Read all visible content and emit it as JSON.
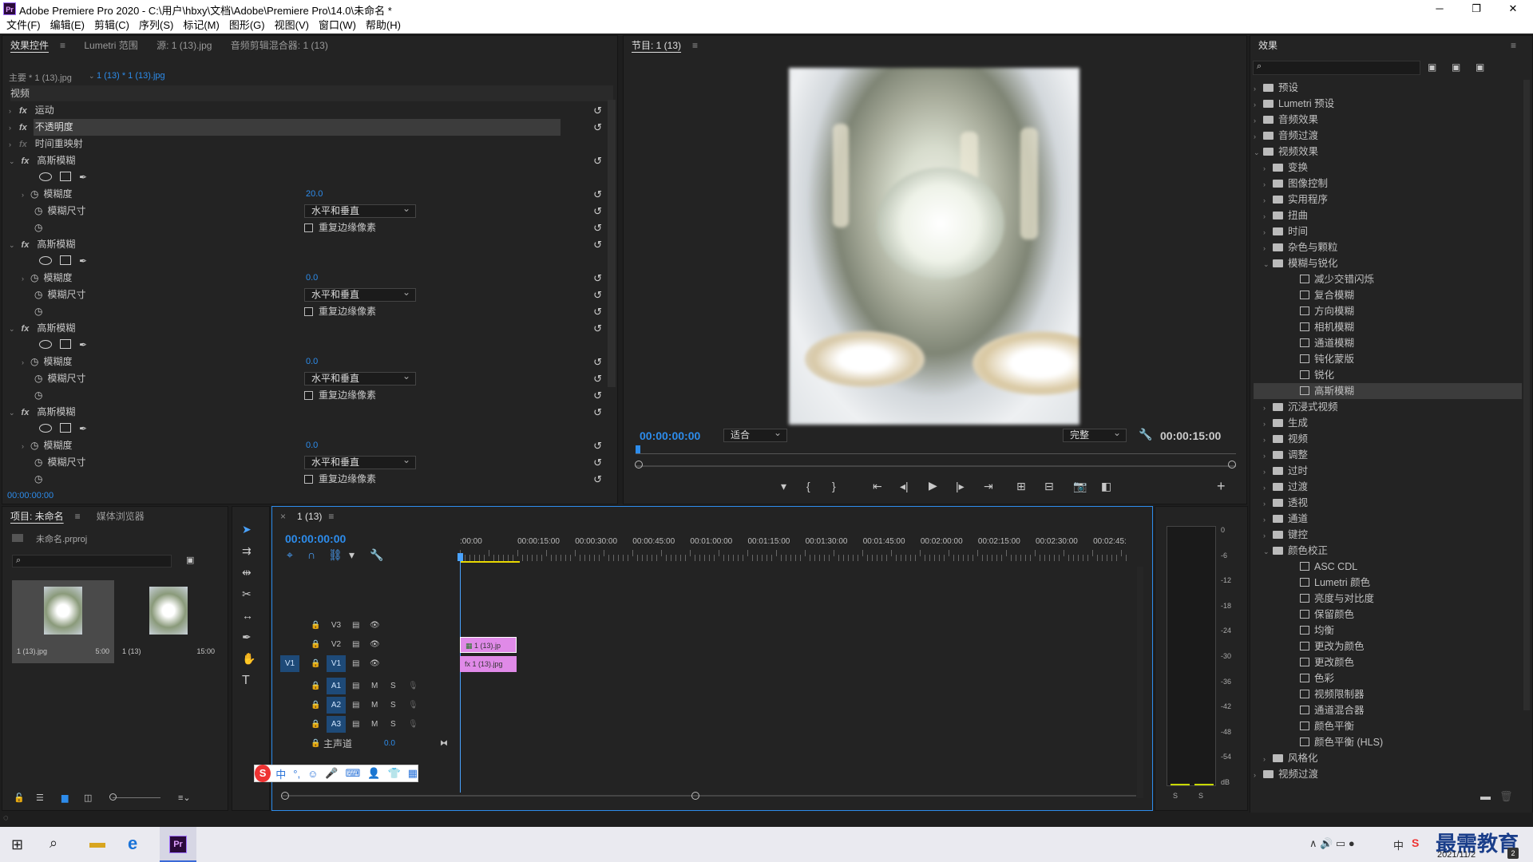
{
  "window": {
    "title": "Adobe Premiere Pro 2020 - C:\\用户\\hbxy\\文档\\Adobe\\Premiere Pro\\14.0\\未命名 *",
    "app_icon": "Pr",
    "minimize": "─",
    "restore": "❐",
    "close": "✕"
  },
  "menu": [
    "文件(F)",
    "编辑(E)",
    "剪辑(C)",
    "序列(S)",
    "标记(M)",
    "图形(G)",
    "视图(V)",
    "窗口(W)",
    "帮助(H)"
  ],
  "effect_controls": {
    "tabs": [
      "效果控件",
      "Lumetri 范围",
      "源: 1 (13).jpg",
      "音频剪辑混合器: 1 (13)"
    ],
    "master": "主要 * 1 (13).jpg",
    "clip": "1 (13) * 1 (13).jpg",
    "section": "视频",
    "fixed": [
      "运动",
      "不透明度",
      "时间重映射"
    ],
    "blur_name": "高斯模糊",
    "blurriness_label": "模糊度",
    "dims_label": "模糊尺寸",
    "repeat_label": "重复边缘像素",
    "dims_value": "水平和垂直",
    "blur_values": [
      "20.0",
      "0.0",
      "0.0",
      "0.0"
    ],
    "timecode": "00:00:00:00"
  },
  "program": {
    "title": "节目: 1 (13)",
    "timecode": "00:00:00:00",
    "fit": "适合",
    "quality": "完整",
    "duration": "00:00:15:00"
  },
  "project": {
    "tabs": [
      "项目: 未命名",
      "媒体浏览器"
    ],
    "file": "未命名.prproj",
    "items": [
      {
        "name": "1 (13).jpg",
        "dur": "5:00"
      },
      {
        "name": "1 (13)",
        "dur": "15:00"
      }
    ]
  },
  "timeline": {
    "tab": "1 (13)",
    "timecode": "00:00:00:00",
    "ruler": [
      ":00:00",
      "00:00:15:00",
      "00:00:30:00",
      "00:00:45:00",
      "00:01:00:00",
      "00:01:15:00",
      "00:01:30:00",
      "00:01:45:00",
      "00:02:00:00",
      "00:02:15:00",
      "00:02:30:00",
      "00:02:45:"
    ],
    "video_tracks": [
      "V3",
      "V2",
      "V1"
    ],
    "audio_tracks": [
      "A1",
      "A2",
      "A3"
    ],
    "src_v": "V1",
    "m": "M",
    "s": "S",
    "master": "主声道",
    "master_val": "0.0",
    "clips": [
      {
        "label": "1 (13).jp"
      },
      {
        "label": "1 (13).jpg"
      }
    ]
  },
  "meter": {
    "ticks": [
      "0",
      "-6",
      "-12",
      "-18",
      "-24",
      "-30",
      "-36",
      "-42",
      "-48",
      "-54",
      "dB"
    ],
    "solo": "S"
  },
  "effects": {
    "title": "效果",
    "tree": [
      {
        "t": "f",
        "l": 0,
        "n": "预设"
      },
      {
        "t": "f",
        "l": 0,
        "n": "Lumetri 预设"
      },
      {
        "t": "f",
        "l": 0,
        "n": "音频效果"
      },
      {
        "t": "f",
        "l": 0,
        "n": "音频过渡"
      },
      {
        "t": "f",
        "l": 0,
        "n": "视频效果",
        "open": true
      },
      {
        "t": "f",
        "l": 1,
        "n": "变换"
      },
      {
        "t": "f",
        "l": 1,
        "n": "图像控制"
      },
      {
        "t": "f",
        "l": 1,
        "n": "实用程序"
      },
      {
        "t": "f",
        "l": 1,
        "n": "扭曲"
      },
      {
        "t": "f",
        "l": 1,
        "n": "时间"
      },
      {
        "t": "f",
        "l": 1,
        "n": "杂色与颗粒"
      },
      {
        "t": "f",
        "l": 1,
        "n": "模糊与锐化",
        "open": true
      },
      {
        "t": "e",
        "l": 2,
        "n": "减少交错闪烁"
      },
      {
        "t": "e",
        "l": 2,
        "n": "复合模糊"
      },
      {
        "t": "e",
        "l": 2,
        "n": "方向模糊"
      },
      {
        "t": "e",
        "l": 2,
        "n": "相机模糊"
      },
      {
        "t": "e",
        "l": 2,
        "n": "通道模糊"
      },
      {
        "t": "e",
        "l": 2,
        "n": "钝化蒙版"
      },
      {
        "t": "e",
        "l": 2,
        "n": "锐化"
      },
      {
        "t": "e",
        "l": 2,
        "n": "高斯模糊",
        "sel": true
      },
      {
        "t": "f",
        "l": 1,
        "n": "沉浸式视频"
      },
      {
        "t": "f",
        "l": 1,
        "n": "生成"
      },
      {
        "t": "f",
        "l": 1,
        "n": "视频"
      },
      {
        "t": "f",
        "l": 1,
        "n": "调整"
      },
      {
        "t": "f",
        "l": 1,
        "n": "过时"
      },
      {
        "t": "f",
        "l": 1,
        "n": "过渡"
      },
      {
        "t": "f",
        "l": 1,
        "n": "透视"
      },
      {
        "t": "f",
        "l": 1,
        "n": "通道"
      },
      {
        "t": "f",
        "l": 1,
        "n": "键控"
      },
      {
        "t": "f",
        "l": 1,
        "n": "颜色校正",
        "open": true
      },
      {
        "t": "e",
        "l": 2,
        "n": "ASC CDL"
      },
      {
        "t": "e",
        "l": 2,
        "n": "Lumetri 颜色"
      },
      {
        "t": "e",
        "l": 2,
        "n": "亮度与对比度"
      },
      {
        "t": "e",
        "l": 2,
        "n": "保留颜色"
      },
      {
        "t": "e",
        "l": 2,
        "n": "均衡"
      },
      {
        "t": "e",
        "l": 2,
        "n": "更改为颜色"
      },
      {
        "t": "e",
        "l": 2,
        "n": "更改颜色"
      },
      {
        "t": "e",
        "l": 2,
        "n": "色彩"
      },
      {
        "t": "e",
        "l": 2,
        "n": "视频限制器"
      },
      {
        "t": "e",
        "l": 2,
        "n": "通道混合器"
      },
      {
        "t": "e",
        "l": 2,
        "n": "颜色平衡"
      },
      {
        "t": "e",
        "l": 2,
        "n": "颜色平衡 (HLS)"
      },
      {
        "t": "f",
        "l": 1,
        "n": "风格化"
      },
      {
        "t": "f",
        "l": 0,
        "n": "视频过渡"
      }
    ]
  },
  "ime": [
    "S",
    "中",
    "°,",
    "☺",
    "🎤",
    "⌨",
    "👤",
    "👕",
    "▦"
  ],
  "taskbar": {
    "date": "2021/11/2",
    "watermark": "最需教育",
    "badge": "2",
    "ime": "中"
  },
  "colors": {
    "accent": "#2d8ceb",
    "clip": "#e08ae8",
    "select": "#3c3c3c"
  }
}
